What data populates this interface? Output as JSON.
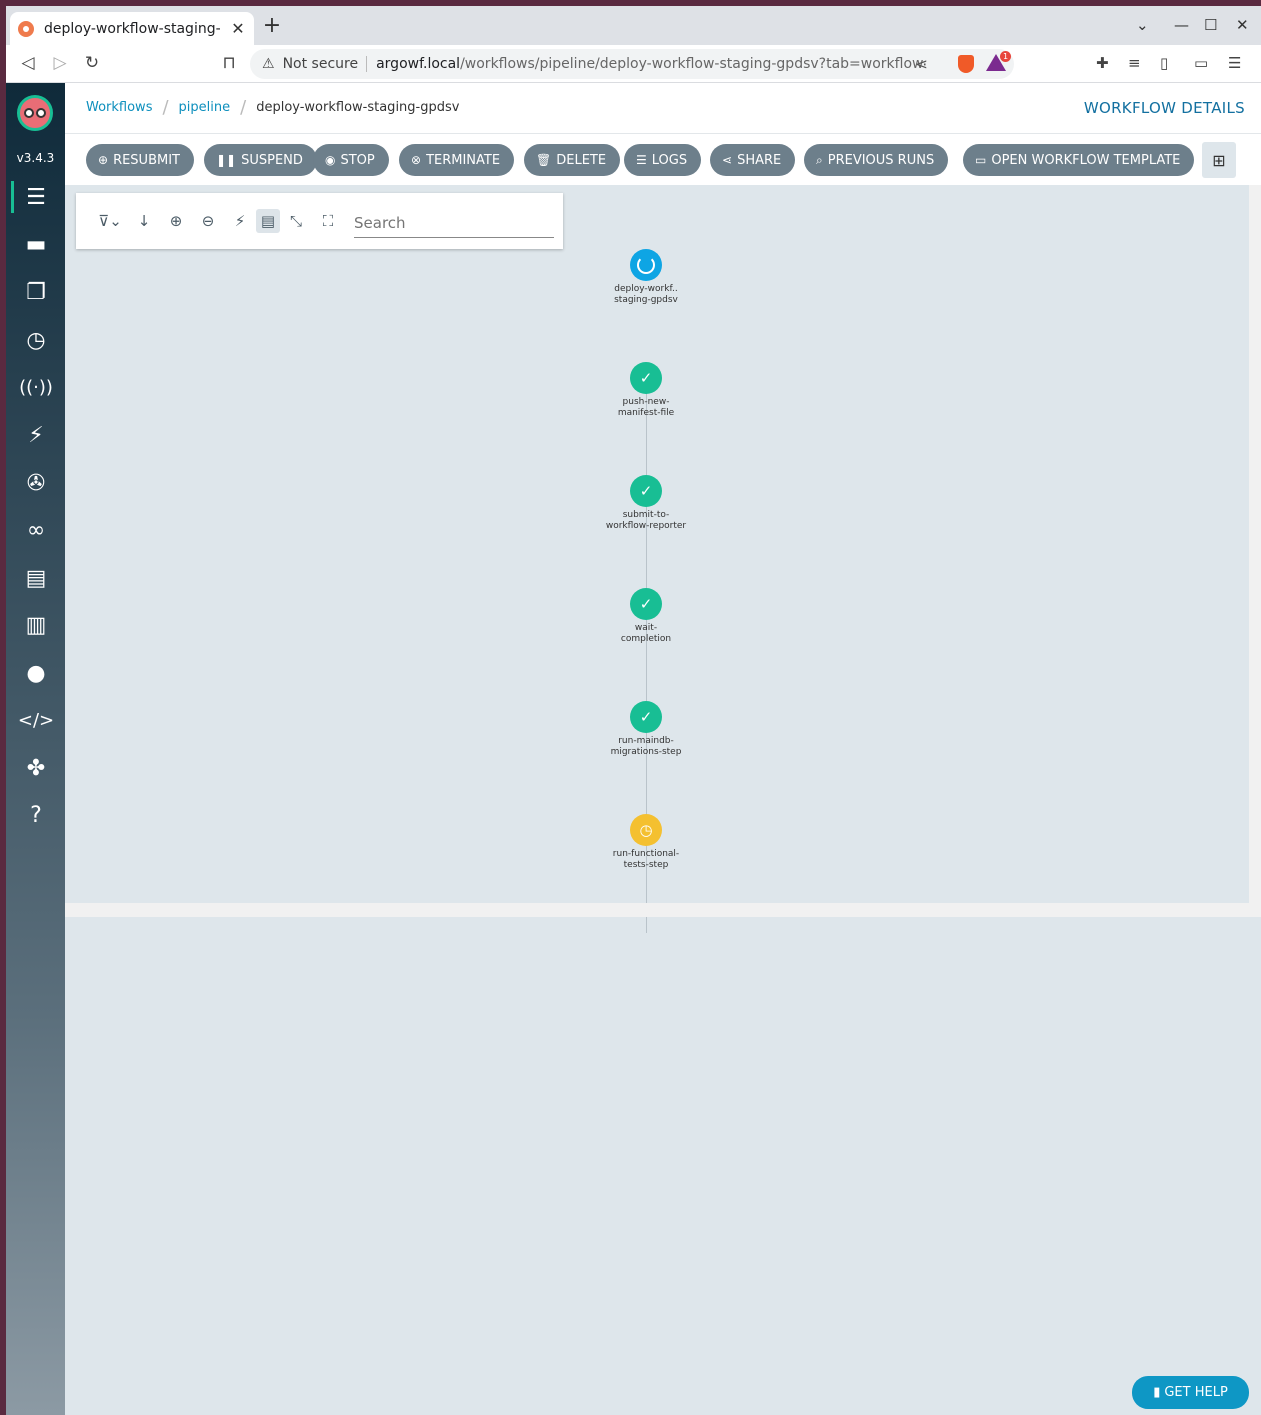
{
  "browser": {
    "tab_title": "deploy-workflow-staging-",
    "security": "Not secure",
    "url_host": "argowf.local",
    "url_path": "/workflows/pipeline/deploy-workflow-staging-gpdsv?tab=workflow",
    "badge_count": "1"
  },
  "sidebar": {
    "version": "v3.4.3",
    "items": [
      "workflows-icon",
      "workflow-templates-icon",
      "cluster-workflow-templates-icon",
      "cron-workflows-icon",
      "event-sources-icon",
      "sensors-icon",
      "event-flow-icon",
      "eventbus-icon",
      "archived-workflows-icon",
      "reports-icon",
      "user-icon",
      "api-docs-icon",
      "plugins-icon",
      "help-icon"
    ]
  },
  "breadcrumbs": [
    "Workflows",
    "pipeline",
    "deploy-workflow-staging-gpdsv"
  ],
  "page_title": "WORKFLOW DETAILS",
  "actions": {
    "resubmit": "RESUBMIT",
    "suspend": "SUSPEND",
    "stop": "STOP",
    "terminate": "TERMINATE",
    "delete": "DELETE",
    "logs": "LOGS",
    "share": "SHARE",
    "previous_runs": "PREVIOUS RUNS",
    "open_template": "OPEN WORKFLOW TEMPLATE"
  },
  "graph": {
    "search_placeholder": "Search",
    "nodes": [
      {
        "line1": "deploy-workf..",
        "line2": "staging-gpdsv",
        "status": "running"
      },
      {
        "line1": "push-new-",
        "line2": "manifest-file",
        "status": "succeeded"
      },
      {
        "line1": "submit-to-",
        "line2": "workflow-reporter",
        "status": "succeeded"
      },
      {
        "line1": "wait-",
        "line2": "completion",
        "status": "succeeded"
      },
      {
        "line1": "run-maindb-",
        "line2": "migrations-step",
        "status": "succeeded"
      },
      {
        "line1": "run-functional-",
        "line2": "tests-step",
        "status": "pending"
      }
    ]
  },
  "help_button": "GET HELP",
  "colors": {
    "running": "#0ea5e4",
    "succeeded": "#18be94",
    "pending": "#f4c030",
    "button": "#6d7f8b",
    "link": "#0d8fbd"
  }
}
